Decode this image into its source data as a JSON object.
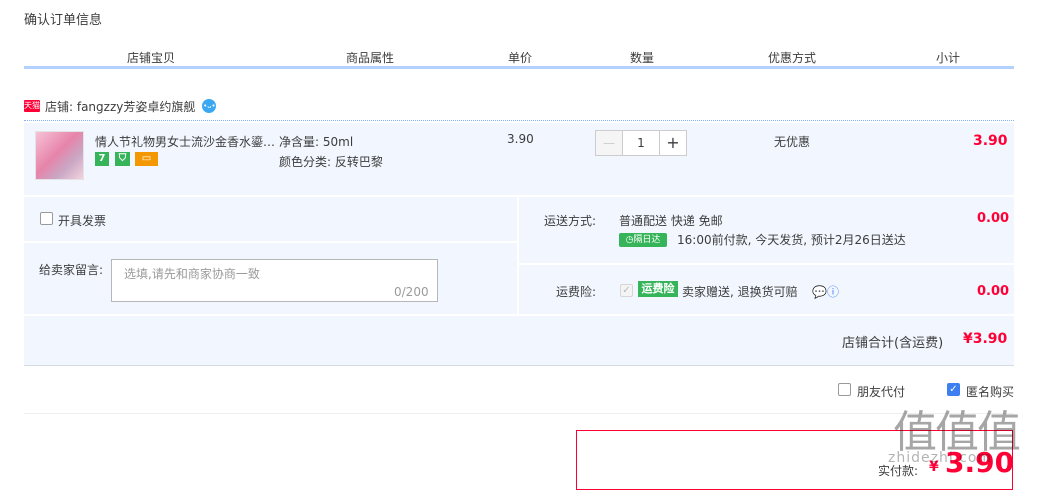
{
  "page_title": "确认订单信息",
  "columns": [
    "店铺宝贝",
    "商品属性",
    "单价",
    "数量",
    "优惠方式",
    "小计"
  ],
  "shop": {
    "badge": "天猫",
    "label": "店铺: fangzzy芳姿卓约旗舰",
    "wangwang_icon": "wangwang-icon"
  },
  "item": {
    "title": "情人节礼物男女士流沙金香水鎏…",
    "service_icons": [
      "7-day-return-icon",
      "guarantee-icon",
      "credit-card-icon"
    ],
    "attr_volume": "净含量: 50ml",
    "attr_color": "颜色分类: 反转巴黎",
    "unit_price": "3.90",
    "quantity": "1",
    "qty_minus": "—",
    "qty_plus": "+",
    "discount": "无优惠",
    "subtotal": "3.90"
  },
  "invoice": {
    "label": "开具发票"
  },
  "message": {
    "label": "给卖家留言:",
    "placeholder": "选填,请先和商家协商一致",
    "counter": "0/200"
  },
  "shipping": {
    "label": "运送方式:",
    "method": "普通配送 快递 免邮",
    "badge": "隔日达",
    "eta": "16:00前付款, 今天发货, 预计2月26日送达",
    "fee": "0.00"
  },
  "insurance": {
    "label": "运费险:",
    "badge": "运费险",
    "text": "卖家赠送, 退换货可赔",
    "fee": "0.00"
  },
  "shop_total": {
    "label": "店铺合计(含运费)",
    "value": "¥3.90"
  },
  "options": {
    "friend_pay": "朋友代付",
    "anonymous": "匿名购买"
  },
  "payment": {
    "label": "实付款:",
    "currency": "¥",
    "amount": "3.90"
  },
  "watermark": {
    "main": "值值值",
    "sub": "zhidezhi.com"
  },
  "colors": {
    "price_red": "#ff0036",
    "header_blue": "#b2d1ff",
    "row_bg": "#f2f7ff",
    "badge_green": "#36b45a"
  }
}
